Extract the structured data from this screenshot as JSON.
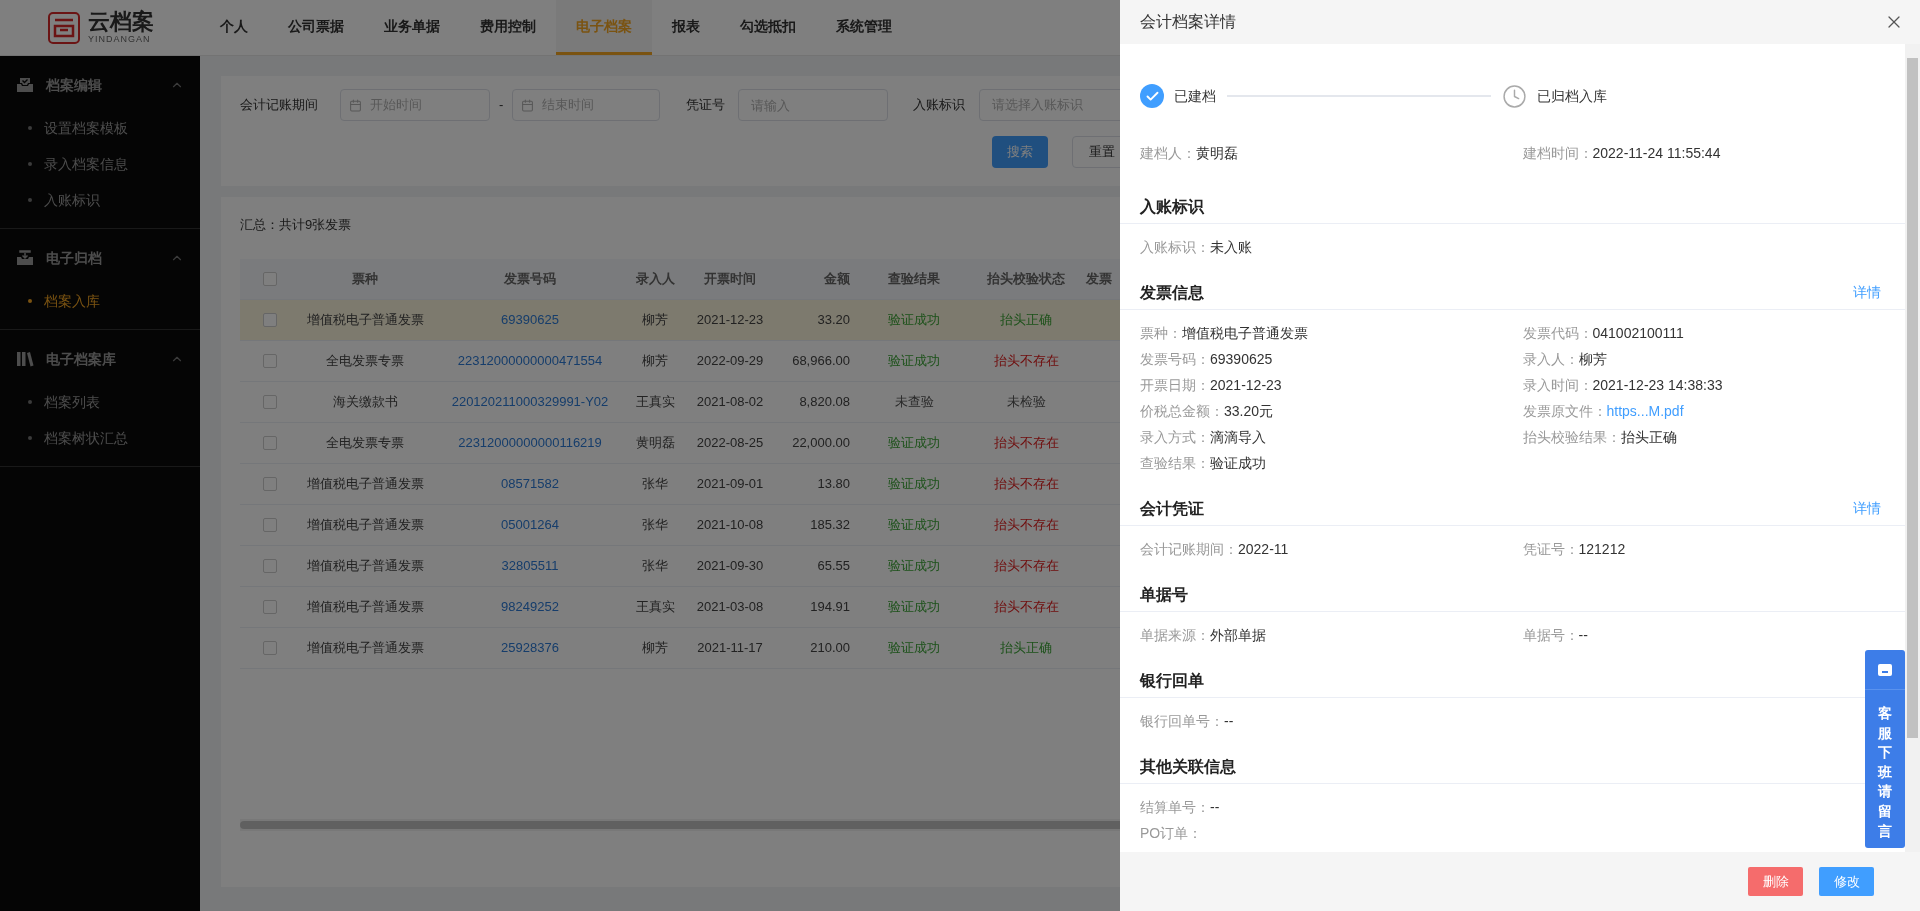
{
  "logo": {
    "name": "云档案",
    "subtitle": "YINDANGAN"
  },
  "nav": [
    {
      "label": "个人",
      "selected": false
    },
    {
      "label": "公司票据",
      "selected": false
    },
    {
      "label": "业务单据",
      "selected": false
    },
    {
      "label": "费用控制",
      "selected": false
    },
    {
      "label": "电子档案",
      "selected": true
    },
    {
      "label": "报表",
      "selected": false
    },
    {
      "label": "勾选抵扣",
      "selected": false
    },
    {
      "label": "系统管理",
      "selected": false
    }
  ],
  "sidebar": [
    {
      "title": "档案编辑",
      "expanded": true,
      "items": [
        {
          "label": "设置档案模板",
          "selected": false
        },
        {
          "label": "录入档案信息",
          "selected": false
        },
        {
          "label": "入账标识",
          "selected": false
        }
      ]
    },
    {
      "title": "电子归档",
      "expanded": true,
      "items": [
        {
          "label": "档案入库",
          "selected": true
        }
      ]
    },
    {
      "title": "电子档案库",
      "expanded": true,
      "items": [
        {
          "label": "档案列表",
          "selected": false
        },
        {
          "label": "档案树状汇总",
          "selected": false
        }
      ]
    }
  ],
  "filters": {
    "period_label": "会计记账期间",
    "start_placeholder": "开始时间",
    "range_separator": "-",
    "end_placeholder": "结束时间",
    "voucher_label": "凭证号",
    "voucher_placeholder": "请输入",
    "entry_label": "入账标识",
    "entry_placeholder": "请选择入账标识",
    "search_button": "搜索",
    "reset_button": "重置"
  },
  "summary": "汇总：共计9张发票",
  "table": {
    "select_all_checked": false,
    "columns": [
      "票种",
      "发票号码",
      "录入人",
      "开票时间",
      "金额",
      "查验结果",
      "抬头校验状态",
      "发票"
    ],
    "rows": [
      {
        "selected": true,
        "checked": false,
        "type": "增值税电子普通发票",
        "number": "69390625",
        "entered_by": "柳芳",
        "date": "2021-12-23",
        "amount": "33.20",
        "check_result": {
          "text": "验证成功",
          "kind": "success"
        },
        "header_check": {
          "text": "抬头正确",
          "kind": "success"
        }
      },
      {
        "selected": false,
        "checked": false,
        "type": "全电发票专票",
        "number": "22312000000000471554",
        "entered_by": "柳芳",
        "date": "2022-09-29",
        "amount": "68,966.00",
        "check_result": {
          "text": "验证成功",
          "kind": "success"
        },
        "header_check": {
          "text": "抬头不存在",
          "kind": "error"
        }
      },
      {
        "selected": false,
        "checked": false,
        "type": "海关缴款书",
        "number": "220120211000329991-Y02",
        "entered_by": "王真实",
        "date": "2021-08-02",
        "amount": "8,820.08",
        "check_result": {
          "text": "未查验",
          "kind": "neutral"
        },
        "header_check": {
          "text": "未检验",
          "kind": "neutral"
        }
      },
      {
        "selected": false,
        "checked": false,
        "type": "全电发票专票",
        "number": "22312000000000116219",
        "entered_by": "黄明磊",
        "date": "2022-08-25",
        "amount": "22,000.00",
        "check_result": {
          "text": "验证成功",
          "kind": "success"
        },
        "header_check": {
          "text": "抬头不存在",
          "kind": "error"
        }
      },
      {
        "selected": false,
        "checked": false,
        "type": "增值税电子普通发票",
        "number": "08571582",
        "entered_by": "张华",
        "date": "2021-09-01",
        "amount": "13.80",
        "check_result": {
          "text": "验证成功",
          "kind": "success"
        },
        "header_check": {
          "text": "抬头不存在",
          "kind": "error"
        }
      },
      {
        "selected": false,
        "checked": false,
        "type": "增值税电子普通发票",
        "number": "05001264",
        "entered_by": "张华",
        "date": "2021-10-08",
        "amount": "185.32",
        "check_result": {
          "text": "验证成功",
          "kind": "success"
        },
        "header_check": {
          "text": "抬头不存在",
          "kind": "error"
        }
      },
      {
        "selected": false,
        "checked": false,
        "type": "增值税电子普通发票",
        "number": "32805511",
        "entered_by": "张华",
        "date": "2021-09-30",
        "amount": "65.55",
        "check_result": {
          "text": "验证成功",
          "kind": "success"
        },
        "header_check": {
          "text": "抬头不存在",
          "kind": "error"
        }
      },
      {
        "selected": false,
        "checked": false,
        "type": "增值税电子普通发票",
        "number": "98249252",
        "entered_by": "王真实",
        "date": "2021-03-08",
        "amount": "194.91",
        "check_result": {
          "text": "验证成功",
          "kind": "success"
        },
        "header_check": {
          "text": "抬头不存在",
          "kind": "error"
        }
      },
      {
        "selected": false,
        "checked": false,
        "type": "增值税电子普通发票",
        "number": "25928376",
        "entered_by": "柳芳",
        "date": "2021-11-17",
        "amount": "210.00",
        "check_result": {
          "text": "验证成功",
          "kind": "success"
        },
        "header_check": {
          "text": "抬头正确",
          "kind": "success"
        }
      }
    ]
  },
  "drawer": {
    "title": "会计档案详情",
    "steps": [
      {
        "label": "已建档",
        "kind": "done"
      },
      {
        "label": "已归档入库",
        "kind": "waiting"
      }
    ],
    "creator": [
      {
        "label": "建档人：",
        "value": "黄明磊"
      },
      {
        "label": "建档时间：",
        "value": "2022-11-24 11:55:44"
      }
    ],
    "sections": [
      {
        "title": "入账标识",
        "kind": "grid",
        "fields": [
          {
            "label": "入账标识：",
            "value": "未入账"
          }
        ]
      },
      {
        "title": "发票信息",
        "kind": "grid",
        "detail_link": "详情",
        "fields": [
          {
            "label": "票种：",
            "value": "增值税电子普通发票"
          },
          {
            "label": "发票代码：",
            "value": "041002100111"
          },
          {
            "label": "发票号码：",
            "value": "69390625"
          },
          {
            "label": "录入人：",
            "value": "柳芳"
          },
          {
            "label": "开票日期：",
            "value": "2021-12-23"
          },
          {
            "label": "录入时间：",
            "value": "2021-12-23 14:38:33"
          },
          {
            "label": "价税总金额：",
            "value": "33.20元"
          },
          {
            "label": "发票原文件：",
            "value": "https...M.pdf",
            "kind": "link"
          },
          {
            "label": "录入方式：",
            "value": "滴滴导入"
          },
          {
            "label": "抬头校验结果：",
            "value": "抬头正确"
          },
          {
            "label": "查验结果：",
            "value": "验证成功"
          }
        ]
      },
      {
        "title": "会计凭证",
        "kind": "grid",
        "detail_link": "详情",
        "fields": [
          {
            "label": "会计记账期间：",
            "value": "2022-11"
          },
          {
            "label": "凭证号：",
            "value": "121212"
          }
        ]
      },
      {
        "title": "单据号",
        "kind": "grid",
        "fields": [
          {
            "label": "单据来源：",
            "value": "外部单据"
          },
          {
            "label": "单据号：",
            "value": "--"
          }
        ]
      },
      {
        "title": "银行回单",
        "kind": "grid",
        "fields": [
          {
            "label": "银行回单号：",
            "value": "--"
          }
        ]
      },
      {
        "title": "其他关联信息",
        "kind": "list",
        "fields": [
          {
            "label": "结算单号：",
            "value": "--"
          },
          {
            "label": "PO订单："
          }
        ]
      }
    ],
    "buttons": [
      {
        "label": "删除",
        "kind": "danger"
      },
      {
        "label": "修改",
        "kind": "primary"
      }
    ]
  },
  "service_widget": {
    "text": "客服下班请留言"
  }
}
